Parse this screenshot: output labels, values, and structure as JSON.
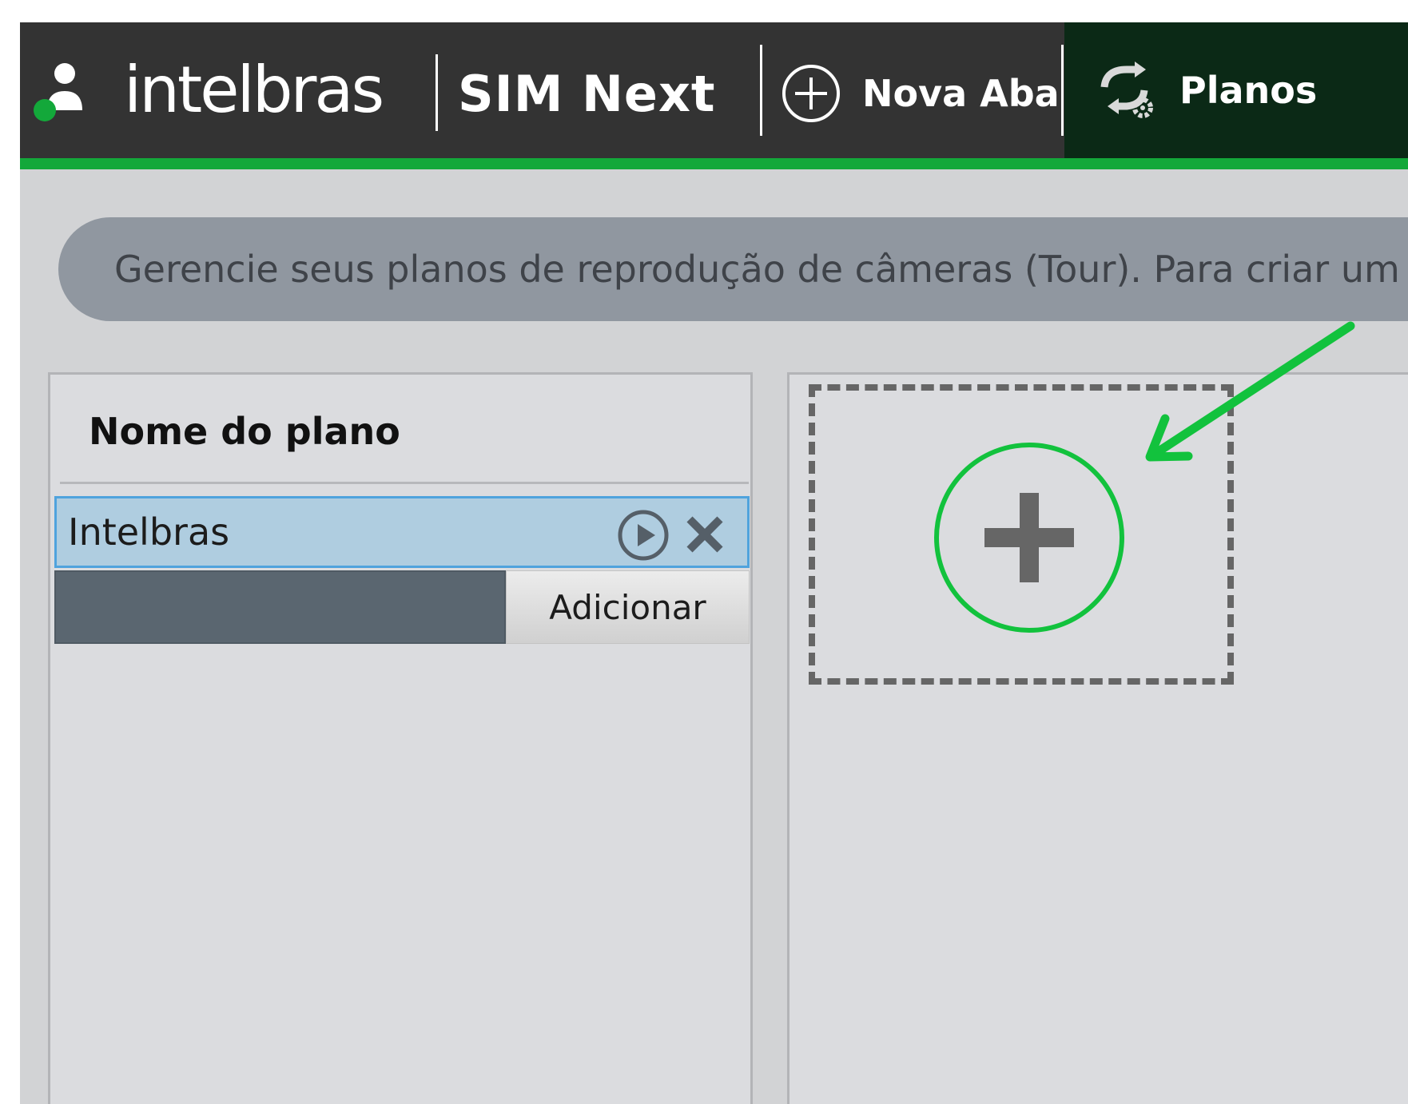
{
  "header": {
    "brand": "intelbras",
    "product": "SIM Next",
    "tabs": [
      {
        "label": "Nova Aba",
        "icon": "plus-circle-icon",
        "active": false
      },
      {
        "label": "Planos",
        "icon": "tour-plan-icon",
        "active": true
      }
    ]
  },
  "banner": {
    "text": "Gerencie seus planos de reprodução de câmeras (Tour). Para criar um"
  },
  "plans_panel": {
    "column_header": "Nome do plano",
    "plans": [
      {
        "name": "Intelbras",
        "selected": true
      }
    ],
    "new_plan_input": {
      "value": "",
      "placeholder": ""
    },
    "add_button_label": "Adicionar"
  },
  "colors": {
    "titlebar": "#333333",
    "accent_green": "#13a83a",
    "active_tab": "#0b2916",
    "banner": "#9097a0",
    "selected_row": "#afcde0",
    "selected_row_border": "#4fa3dd"
  }
}
